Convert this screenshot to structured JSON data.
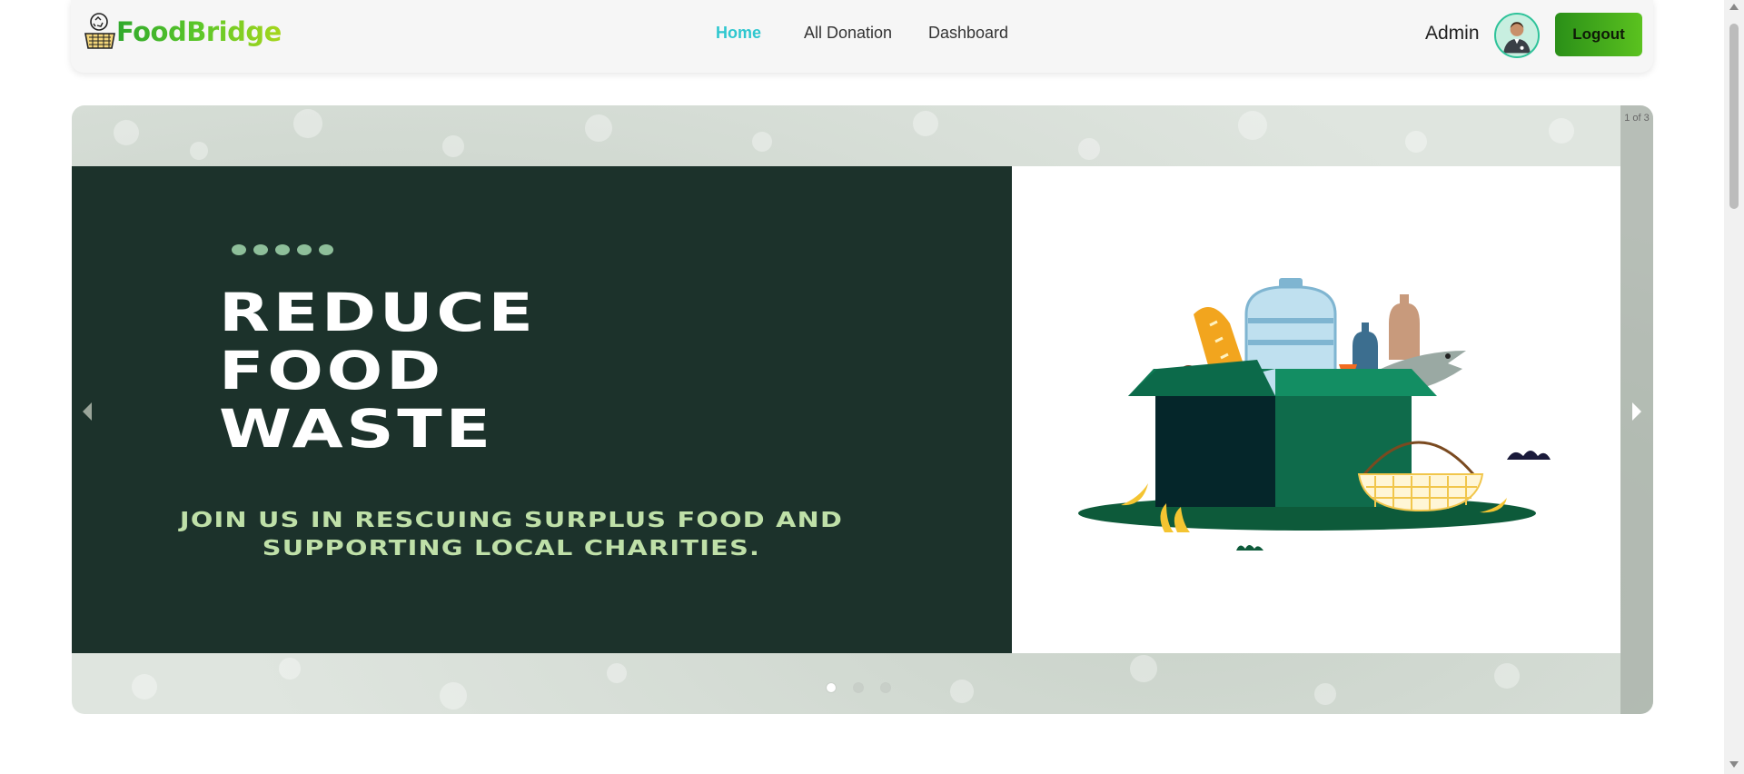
{
  "brand": {
    "name": "FoodBridge",
    "icon": "food-basket-recycle-icon"
  },
  "nav": {
    "links": [
      {
        "label": "Home",
        "active": true
      },
      {
        "label": "All Donation",
        "active": false
      },
      {
        "label": "Dashboard",
        "active": false
      }
    ]
  },
  "user": {
    "name": "Admin",
    "avatar_icon": "user-avatar-icon",
    "logout_label": "Logout"
  },
  "carousel": {
    "counter": "1 of 3",
    "current_slide": 1,
    "total_slides": 3,
    "slide": {
      "headline_lines": [
        "REDUCE",
        "FOOD",
        "WASTE"
      ],
      "subtitle": "JOIN US IN RESCUING SURPLUS FOOD AND SUPPORTING LOCAL CHARITIES.",
      "image_icon": "food-donation-box-illustration"
    },
    "prev_icon": "chevron-left-icon",
    "next_icon": "chevron-right-icon"
  },
  "colors": {
    "brand_green": "#2fa82c",
    "nav_active": "#2ec7cf",
    "slide_dark": "#1c322b",
    "subtitle_green": "#bfe0a8",
    "logout_gradient_start": "#2a8f18",
    "logout_gradient_end": "#5bc21f"
  }
}
